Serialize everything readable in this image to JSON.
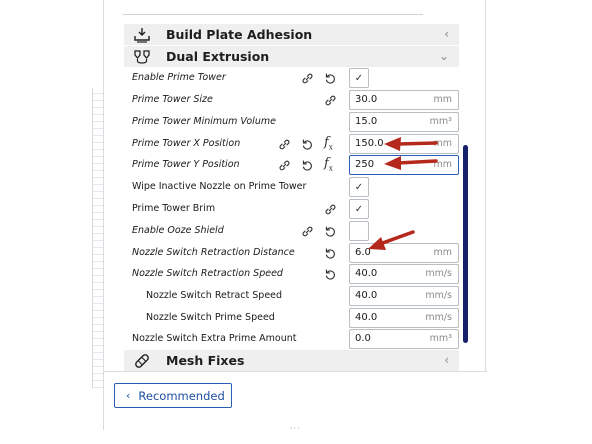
{
  "sections": {
    "build_plate_adhesion": {
      "title": "Build Plate Adhesion"
    },
    "dual_extrusion": {
      "title": "Dual Extrusion"
    },
    "mesh_fixes": {
      "title": "Mesh Fixes"
    }
  },
  "settings": {
    "enable_prime_tower": {
      "label": "Enable Prime Tower",
      "checked": true
    },
    "prime_tower_size": {
      "label": "Prime Tower Size",
      "value": "30.0",
      "unit": "mm"
    },
    "prime_tower_min_volume": {
      "label": "Prime Tower Minimum Volume",
      "value": "15.0",
      "unit": "mm³"
    },
    "prime_tower_x": {
      "label": "Prime Tower X Position",
      "value": "150.0",
      "unit": "mm"
    },
    "prime_tower_y": {
      "label": "Prime Tower Y Position",
      "value": "250",
      "unit": "mm"
    },
    "wipe_inactive_nozzle": {
      "label": "Wipe Inactive Nozzle on Prime Tower",
      "checked": true
    },
    "prime_tower_brim": {
      "label": "Prime Tower Brim",
      "checked": true
    },
    "enable_ooze_shield": {
      "label": "Enable Ooze Shield",
      "checked": false
    },
    "nozzle_switch_retraction_distance": {
      "label": "Nozzle Switch Retraction Distance",
      "value": "6.0",
      "unit": "mm"
    },
    "nozzle_switch_retraction_speed": {
      "label": "Nozzle Switch Retraction Speed",
      "value": "40.0",
      "unit": "mm/s"
    },
    "nozzle_switch_retract_speed": {
      "label": "Nozzle Switch Retract Speed",
      "value": "40.0",
      "unit": "mm/s"
    },
    "nozzle_switch_prime_speed": {
      "label": "Nozzle Switch Prime Speed",
      "value": "40.0",
      "unit": "mm/s"
    },
    "nozzle_switch_extra_prime_amount": {
      "label": "Nozzle Switch Extra Prime Amount",
      "value": "0.0",
      "unit": "mm³"
    }
  },
  "checkmark": "✓",
  "fx_symbol": "f",
  "fx_sub": "x",
  "footer": {
    "recommended_label": "Recommended"
  },
  "colors": {
    "accent": "#2b5fb5",
    "annotation_arrow": "#b5281c",
    "scrollbar": "#16206b",
    "section_bg": "#efefef"
  },
  "icons": {
    "build_plate_adhesion": "tray-arrow-icon",
    "dual_extrusion": "dual-nozzle-icon",
    "mesh_fixes": "bandage-icon",
    "linked": "link-icon",
    "reset": "reset-icon",
    "formula": "fx-icon"
  }
}
